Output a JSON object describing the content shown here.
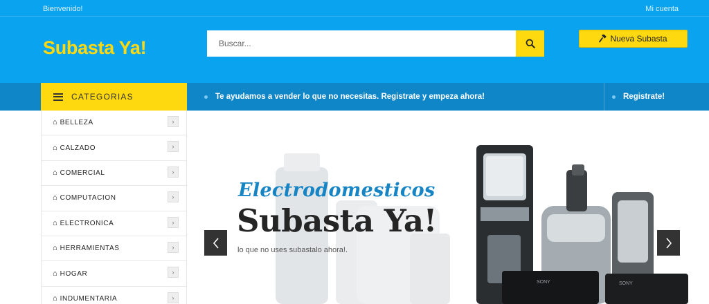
{
  "topbar": {
    "welcome": "Bienvenido!",
    "account": "Mi cuenta"
  },
  "header": {
    "logo": "Subasta Ya!",
    "search_placeholder": "Buscar...",
    "new_auction_label": "Nueva Subasta"
  },
  "nav": {
    "categories_label": "CATEGORIAS",
    "message": "Te ayudamos a vender lo que no necesitas. Registrate y empeza ahora!",
    "register_label": "Registrate!"
  },
  "sidebar": {
    "items": [
      {
        "label": "BELLEZA"
      },
      {
        "label": "CALZADO"
      },
      {
        "label": "COMERCIAL"
      },
      {
        "label": "COMPUTACION"
      },
      {
        "label": "ELECTRONICA"
      },
      {
        "label": "HERRAMIENTAS"
      },
      {
        "label": "HOGAR"
      },
      {
        "label": "INDUMENTARIA"
      }
    ]
  },
  "hero": {
    "kicker": "Electrodomesticos",
    "title": "Subasta Ya!",
    "subtitle": "lo que no uses subastalo ahora!."
  },
  "colors": {
    "brand_blue": "#0aa3ef",
    "nav_blue": "#0f86c8",
    "accent_yellow": "#ffd90f"
  },
  "icons": [
    "search-icon",
    "gavel-icon",
    "menu-icon",
    "home-icon",
    "chevron-right-icon",
    "chevron-left-icon"
  ]
}
